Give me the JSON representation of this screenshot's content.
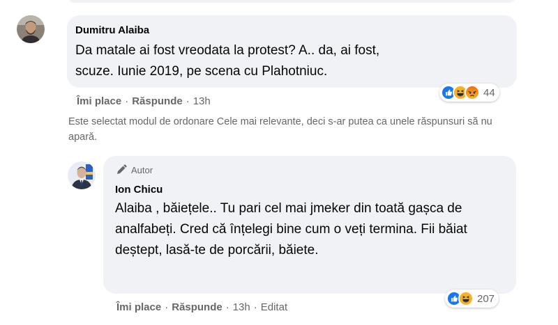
{
  "comments": [
    {
      "author": "Dumitru Alaiba",
      "text": "Da matale ai fost vreodata la protest? A.. da, ai fost, scuze. Iunie 2019, pe scena cu Plahotniuc.",
      "like_label": "Îmi place",
      "reply_label": "Răspunde",
      "time": "13h",
      "reaction_count": "44",
      "reactions": [
        "like-icon",
        "haha-icon",
        "angry-icon"
      ]
    },
    {
      "badge": "Autor",
      "author": "Ion Chicu",
      "text": "Alaiba , băiețele.. Tu pari cel mai jmeker din toată gașca de analfabeți. Cred că înțelegi bine cum o veți termina. Fii băiat deștept, lasă-te de porcării, băiete.",
      "like_label": "Îmi place",
      "reply_label": "Răspunde",
      "time": "13h",
      "edited_label": "Editat",
      "reaction_count": "207",
      "reactions": [
        "like-icon",
        "haha-icon"
      ]
    }
  ],
  "sort_notice": "Este selectat modul de ordonare Cele mai relevante, deci s-ar putea ca unele răspunsuri să nu apară.",
  "colors": {
    "bubble": "#f0f2f5",
    "secondary_text": "#65676b",
    "like_blue": "#1877f2",
    "haha_yellow": "#f7b125",
    "angry_orange": "#e9710f"
  }
}
